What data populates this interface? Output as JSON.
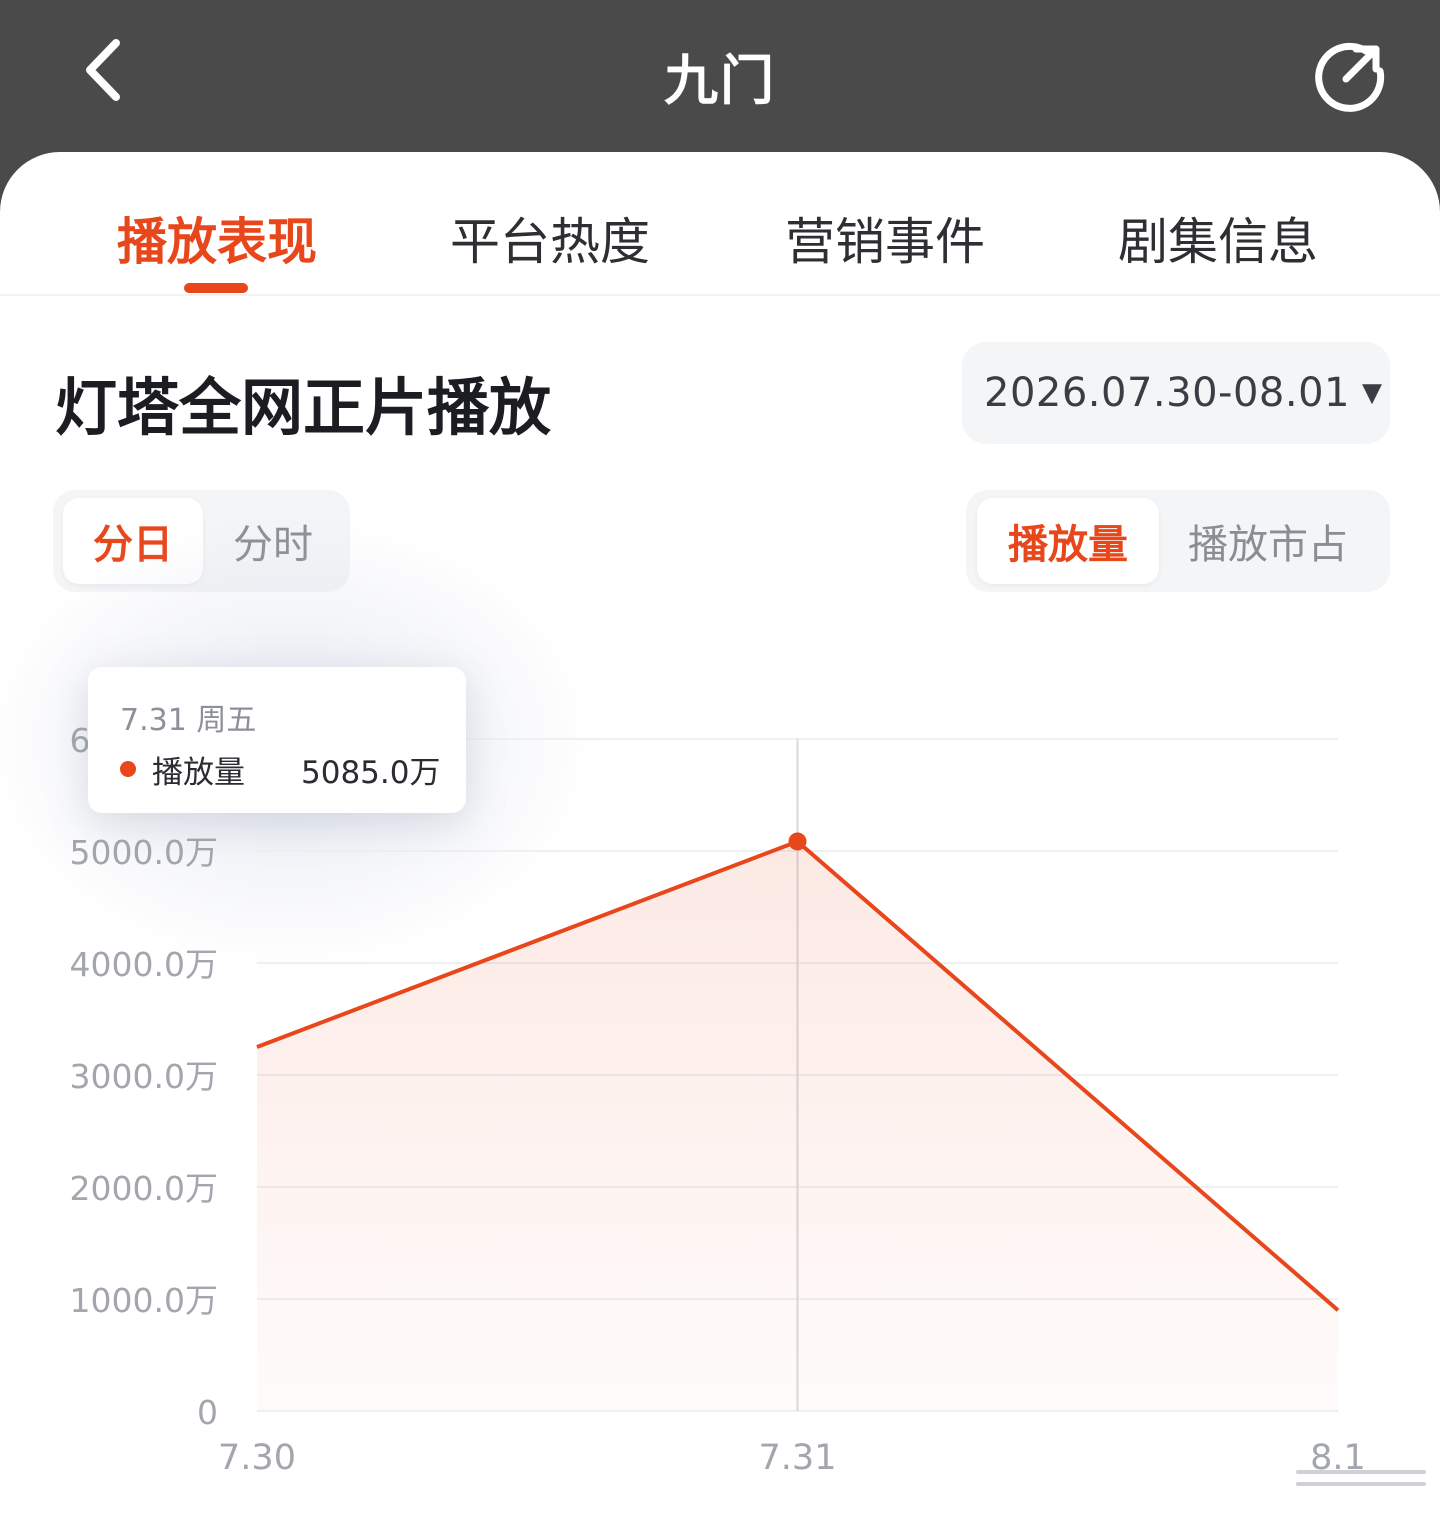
{
  "header": {
    "title": "九门"
  },
  "tabs": [
    {
      "label": "播放表现",
      "active": true
    },
    {
      "label": "平台热度",
      "active": false
    },
    {
      "label": "营销事件",
      "active": false
    },
    {
      "label": "剧集信息",
      "active": false
    }
  ],
  "section": {
    "title": "灯塔全网正片播放",
    "date_range": "2026.07.30-08.01",
    "granularity": [
      {
        "label": "分日",
        "active": true
      },
      {
        "label": "分时",
        "active": false
      }
    ],
    "metric": [
      {
        "label": "播放量",
        "active": true
      },
      {
        "label": "播放市占",
        "active": false
      }
    ]
  },
  "tooltip": {
    "date": "7.31  周五",
    "series_label": "播放量",
    "value": "5085.0万"
  },
  "colors": {
    "accent": "#e8461b",
    "header_bg": "#4a4a4a"
  },
  "chart_data": {
    "type": "area",
    "x": [
      "7.30",
      "7.31",
      "8.1"
    ],
    "series": [
      {
        "name": "播放量",
        "values": [
          3250,
          5085,
          900
        ],
        "unit": "万"
      }
    ],
    "ylim": [
      0,
      6000
    ],
    "yticks": [
      "0",
      "1000.0万",
      "2000.0万",
      "3000.0万",
      "4000.0万",
      "5000.0万",
      "6000.0万"
    ],
    "ytick_values": [
      0,
      1000,
      2000,
      3000,
      4000,
      5000,
      6000
    ],
    "highlight_index": 1,
    "grid": true
  }
}
